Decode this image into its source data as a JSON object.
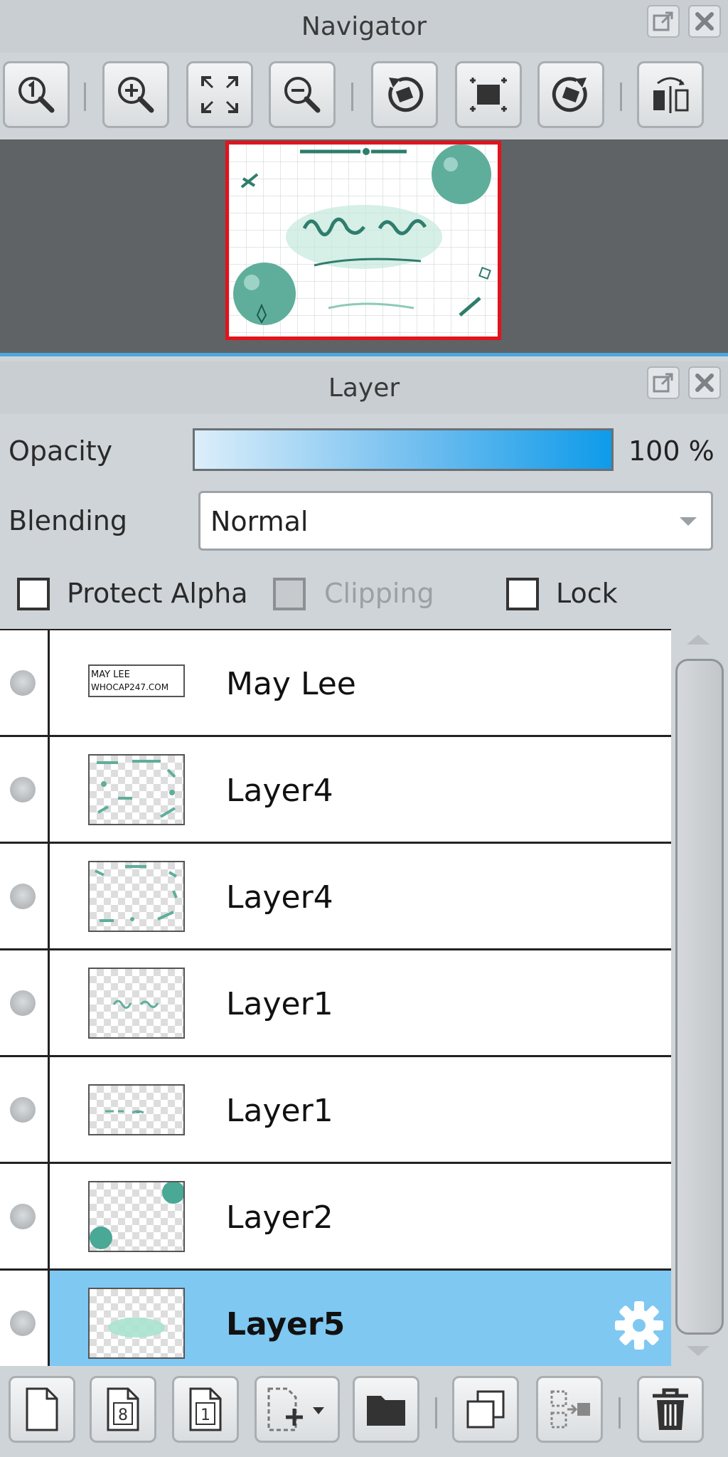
{
  "navigator": {
    "title": "Navigator"
  },
  "layer_panel": {
    "title": "Layer",
    "opacity_label": "Opacity",
    "opacity_value": "100 %",
    "opacity_fraction": 1.0,
    "blending_label": "Blending",
    "blending_value": "Normal",
    "protect_alpha_label": "Protect Alpha",
    "clipping_label": "Clipping",
    "lock_label": "Lock"
  },
  "layers": [
    {
      "name": "May Lee",
      "selected": false
    },
    {
      "name": "Layer4",
      "selected": false
    },
    {
      "name": "Layer4",
      "selected": false
    },
    {
      "name": "Layer1",
      "selected": false
    },
    {
      "name": "Layer1",
      "selected": false
    },
    {
      "name": "Layer2",
      "selected": false
    },
    {
      "name": "Layer5",
      "selected": true
    }
  ],
  "thumb_text": {
    "may_lee_line1": "MAY LEE",
    "may_lee_line2": "WHOCAP247.COM"
  },
  "colors": {
    "accent_selected": "#7fc8f2",
    "opacity_bar": "#0e9bea",
    "nav_frame": "#e3121b",
    "teal": "#4aa896"
  }
}
